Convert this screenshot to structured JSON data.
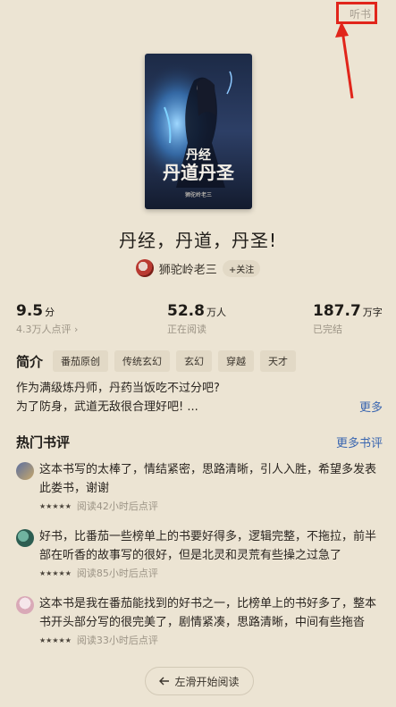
{
  "top_right_link": "听书",
  "book": {
    "title": "丹经，丹道，丹圣!",
    "cover_title": "丹经 丹道丹圣",
    "cover_author": "狮驼岭老三"
  },
  "author": {
    "name": "狮驼岭老三",
    "follow_label": "+关注"
  },
  "stats": [
    {
      "value": "9.5",
      "unit": "分",
      "sub": "4.3万人点评 ›"
    },
    {
      "value": "52.8",
      "unit": "万人",
      "sub": "正在阅读"
    },
    {
      "value": "187.7",
      "unit": "万字",
      "sub": "已完结"
    }
  ],
  "intro": {
    "label": "简介",
    "tags": [
      "番茄原创",
      "传统玄幻",
      "玄幻",
      "穿越",
      "天才"
    ],
    "line1": "作为满级炼丹师，丹药当饭吃不过分吧?",
    "line2": "为了防身，武道无敌很合理好吧! ...",
    "more_label": "更多"
  },
  "reviews_section": {
    "title": "热门书评",
    "more_label": "更多书评",
    "items": [
      {
        "text": "这本书写的太棒了，情结紧密，思路清晰，引人入胜，希望多发表此娄书，谢谢",
        "stars": "★★★★★",
        "meta": "阅读42小时后点评"
      },
      {
        "text": "好书，比番茄一些榜单上的书要好得多，逻辑完整，不拖拉，前半部在听香的故事写的很好，但是北灵和灵荒有些操之过急了",
        "stars": "★★★★★",
        "meta": "阅读85小时后点评"
      },
      {
        "text": "这本书是我在番茄能找到的好书之一，比榜单上的书好多了，整本书开头部分写的很完美了，剧情紧凑，思路清晰，中间有些拖沓",
        "stars": "★★★★★",
        "meta": "阅读33小时后点评"
      }
    ]
  },
  "start_reading_label": "左滑开始阅读",
  "colors": {
    "background": "#ece4d3",
    "link_blue": "#3a66b0",
    "annotation_red": "#e1251b"
  }
}
